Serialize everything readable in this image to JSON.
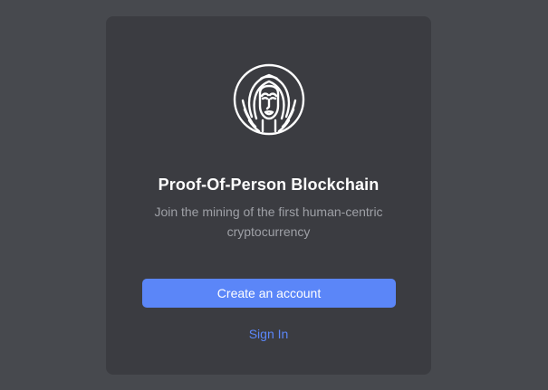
{
  "card": {
    "logo_icon": "face-mask-logo-icon",
    "title": "Proof-Of-Person Blockchain",
    "subtitle": "Join the mining of the first human-centric cryptocurrency",
    "create_account_label": "Create an account",
    "sign_in_label": "Sign In"
  },
  "colors": {
    "page_background": "#47494e",
    "card_background": "#3b3c41",
    "accent": "#5b86f8",
    "title_text": "#ffffff",
    "subtitle_text": "#9ea0a6"
  }
}
